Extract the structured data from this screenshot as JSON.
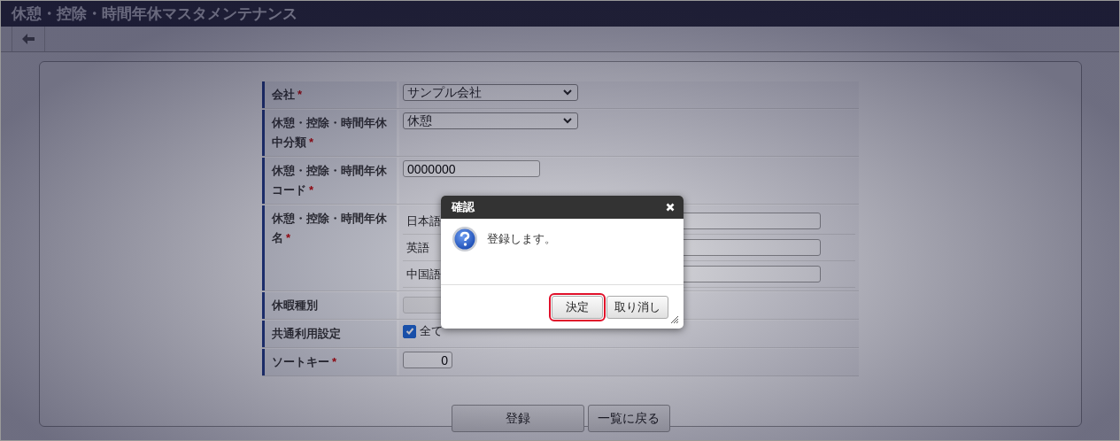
{
  "title": "休憩・控除・時間年休マスタメンテナンス",
  "form": [
    {
      "kind": "select",
      "label": "会社",
      "mark": "*",
      "value": "サンプル会社"
    },
    {
      "kind": "select",
      "label": "休憩・控除・時間年休中分類",
      "mark": "*",
      "value": "休憩"
    },
    {
      "kind": "text",
      "label": "休憩・控除・時間年休コード",
      "mark": "*",
      "value": "0000000"
    },
    {
      "kind": "names",
      "label": "休憩・控除・時間年休名",
      "mark": "*",
      "languages": [
        "日本語",
        "英語",
        "中国語"
      ]
    },
    {
      "kind": "disabled",
      "label": "休暇種別"
    },
    {
      "kind": "checkbox",
      "label": "共通利用設定",
      "checked": true,
      "option": "全て"
    },
    {
      "kind": "number",
      "label": "ソートキー",
      "mark": "*",
      "value": "0"
    }
  ],
  "buttons": [
    "登録",
    "一覧に戻る"
  ],
  "dialog": {
    "title": "確認",
    "message": "登録します。",
    "buttons": [
      {
        "label": "決定",
        "focused": true
      },
      {
        "label": "取り消し",
        "focused": false
      }
    ]
  }
}
